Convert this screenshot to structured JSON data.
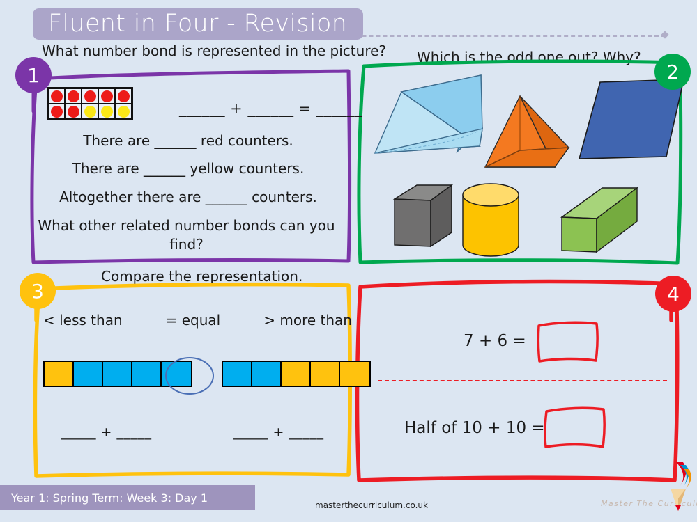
{
  "header": {
    "title": "Fluent in Four - Revision"
  },
  "footer": {
    "banner_label": "Year 1: Spring Term: Week 3: Day 1",
    "url": "masterthecurriculum.co.uk",
    "brand_wordmark": "Master The Curriculum"
  },
  "questions": [
    {
      "number": "1",
      "accent": "#7b35a8",
      "heading": "What number bond is represented in the picture?",
      "equation": "______ + ______ = ______",
      "sentences": [
        "There are ______ red counters.",
        "There are ______ yellow counters.",
        "Altogether there are ______  counters.",
        "What other related number bonds can you find?"
      ],
      "tenframe": {
        "rows": [
          [
            "red",
            "red",
            "red",
            "red",
            "red"
          ],
          [
            "red",
            "red",
            "yellow",
            "yellow",
            "yellow"
          ]
        ],
        "red_count": "7",
        "yellow_count": "3",
        "total": "10"
      }
    },
    {
      "number": "2",
      "accent": "#00a84f",
      "heading": "Which is the odd one out? Why?",
      "shapes": [
        {
          "name": "triangular-prism",
          "color": "#8ccdee",
          "kind": "3D"
        },
        {
          "name": "square-pyramid",
          "color": "#f47920",
          "kind": "3D"
        },
        {
          "name": "parallelogram",
          "color": "#4065b0",
          "kind": "2D"
        },
        {
          "name": "cube",
          "color": "#706f6f",
          "kind": "3D"
        },
        {
          "name": "cylinder",
          "color": "#fdc300",
          "kind": "3D"
        },
        {
          "name": "cuboid",
          "color": "#8cc252",
          "kind": "3D"
        }
      ]
    },
    {
      "number": "3",
      "accent": "#ffc20e",
      "heading": "Compare the representation.",
      "key": [
        "< less than",
        "= equal",
        "> more than"
      ],
      "bar_left": [
        "yellow",
        "blue",
        "blue",
        "blue",
        "blue"
      ],
      "bar_right": [
        "blue",
        "blue",
        "yellow",
        "yellow",
        "yellow"
      ],
      "blank_left": "_____ + _____",
      "blank_right": "_____ + _____"
    },
    {
      "number": "4",
      "accent": "#ed1c24",
      "calculations": [
        "7 + 6 =",
        "Half of 10 + 10 ="
      ]
    }
  ],
  "colors": {
    "background": "#dce6f2",
    "title_banner": "#aba5c9",
    "footer_banner": "#9e94bd",
    "counter_red": "#ed1b18",
    "counter_yellow": "#fbe817",
    "bar_blue": "#00aeef",
    "bar_yellow": "#ffc20e"
  }
}
